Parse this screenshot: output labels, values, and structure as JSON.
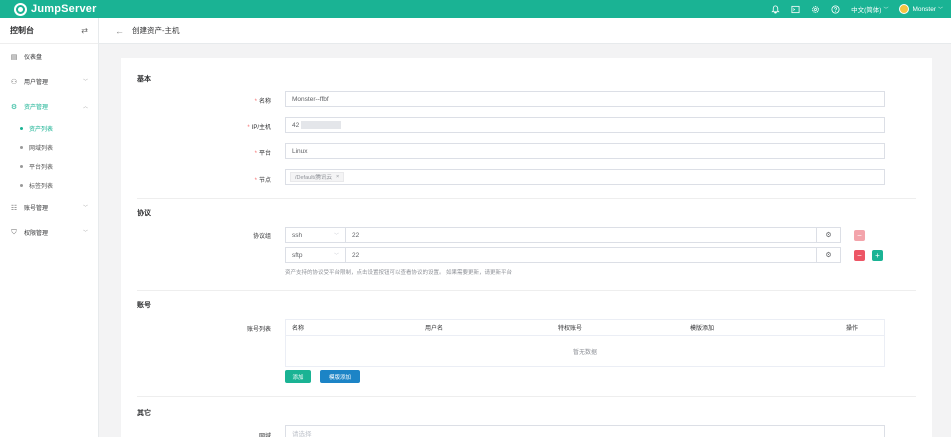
{
  "topbar": {
    "logo_text": "JumpServer",
    "language": "中文(简体)",
    "user_name": "Monster"
  },
  "sidebar": {
    "title": "控制台",
    "items": [
      {
        "label": "仪表盘"
      },
      {
        "label": "用户管理"
      },
      {
        "label": "资产管理"
      },
      {
        "label": "账号管理"
      },
      {
        "label": "权限管理"
      }
    ],
    "sub_items": [
      {
        "label": "资产列表"
      },
      {
        "label": "网域列表"
      },
      {
        "label": "平台列表"
      },
      {
        "label": "标签列表"
      }
    ]
  },
  "header": {
    "title": "创建资产-主机"
  },
  "form": {
    "basic": {
      "section": "基本",
      "name_label": "名称",
      "name_value": "Monster--ffbf",
      "ip_label": "IP/主机",
      "ip_value": "42",
      "platform_label": "平台",
      "platform_value": "Linux",
      "node_label": "节点",
      "node_tag": "/Default/腾讯云",
      "node_tag_close": "×"
    },
    "protocol": {
      "section": "协议",
      "group_label": "协议组",
      "rows": [
        {
          "name": "ssh",
          "port": "22"
        },
        {
          "name": "sftp",
          "port": "22"
        }
      ],
      "help": "资产支持的协议受平台限制，点击设置按钮可以查看协议的设置。 如果需要更新，请更新平台"
    },
    "account": {
      "section": "账号",
      "list_label": "账号列表",
      "columns": [
        "名称",
        "用户名",
        "特权账号",
        "模版添加",
        "操作"
      ],
      "empty_text": "暂无数据",
      "add_button": "添加",
      "template_add_button": "模版添加"
    },
    "other": {
      "section": "其它",
      "domain_label": "网域",
      "domain_placeholder": "请选择"
    }
  },
  "colors": {
    "brand": "#1ab394",
    "danger": "#ed5565",
    "info": "#1c84c6"
  }
}
